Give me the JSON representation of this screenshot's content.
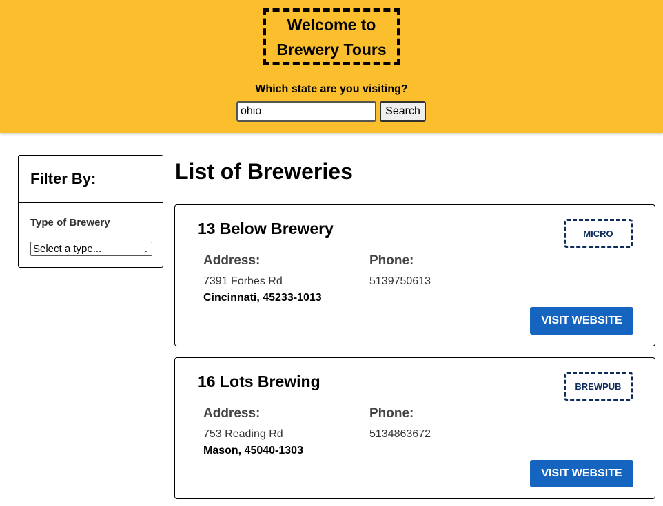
{
  "header": {
    "title_line1": "Welcome to",
    "title_line2": "Brewery Tours",
    "state_question": "Which state are you visiting?",
    "search_value": "ohio",
    "search_button_label": "Search",
    "background_color": "#fbbf2e"
  },
  "filter": {
    "title": "Filter By:",
    "type_label": "Type of Brewery",
    "type_select_value": "Select a type..."
  },
  "main": {
    "title": "List of Breweries",
    "breweries": [
      {
        "name": "13 Below Brewery",
        "type": "MICRO",
        "address_label": "Address:",
        "street": "7391 Forbes Rd",
        "city_zip": "Cincinnati, 45233-1013",
        "phone_label": "Phone:",
        "phone": "5139750613",
        "visit_label": "VISIT WEBSITE"
      },
      {
        "name": "16 Lots Brewing",
        "type": "BREWPUB",
        "address_label": "Address:",
        "street": "753 Reading Rd",
        "city_zip": "Mason, 45040-1303",
        "phone_label": "Phone:",
        "phone": "5134863672",
        "visit_label": "VISIT WEBSITE"
      }
    ]
  },
  "colors": {
    "accent_yellow": "#fbbf2e",
    "button_blue": "#1565c0",
    "badge_navy": "#0d2c5c"
  }
}
